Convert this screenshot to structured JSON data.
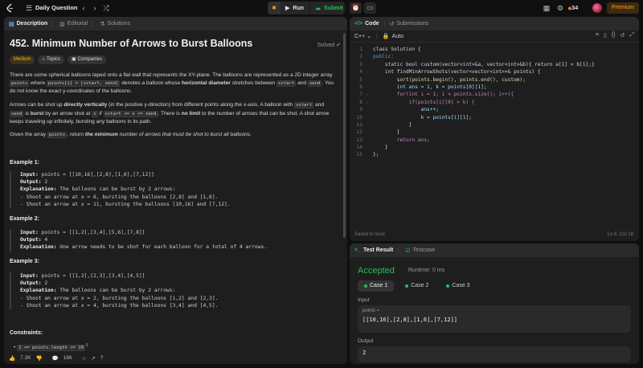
{
  "topbar": {
    "title": "Daily Question",
    "run_label": "Run",
    "submit_label": "Submit",
    "streak": "34",
    "premium_label": "Premium"
  },
  "left_tabs": [
    "Description",
    "Editorial",
    "Solutions"
  ],
  "problem": {
    "title": "452. Minimum Number of Arrows to Burst Balloons",
    "status": "Solved",
    "difficulty": "Medium",
    "topics_label": "Topics",
    "companies_label": "Companies",
    "p1_a": "There are some spherical balloons taped onto a flat wall that represents the XY-plane. The balloons are represented as a 2D integer array ",
    "p1_code1": "points",
    "p1_b": " where ",
    "p1_code2": "points[i] = [xstart, xend]",
    "p1_c": " denotes a balloon whose ",
    "p1_bold": "horizontal diameter",
    "p1_d": " stretches between ",
    "p1_code3": "xstart",
    "p1_e": " and ",
    "p1_code4": "xend",
    "p1_f": ". You do not know the exact y-coordinates of the balloons.",
    "p2_a": "Arrows can be shot up ",
    "p2_bold1": "directly vertically",
    "p2_b": " (in the positive y-direction) from different points along the x-axis. A balloon with ",
    "p2_code1": "xstart",
    "p2_c": " and ",
    "p2_code2": "xend",
    "p2_d": " is ",
    "p2_bold2": "burst",
    "p2_e": " by an arrow shot at ",
    "p2_code3": "x",
    "p2_f": " if ",
    "p2_code4": "xstart <= x <= xend",
    "p2_g": ". There is ",
    "p2_bold3": "no limit",
    "p2_h": " to the number of arrows that can be shot. A shot arrow keeps traveling up infinitely, bursting any balloons in its path.",
    "p3_a": "Given the array ",
    "p3_code": "points",
    "p3_b": ", return ",
    "p3_em": "the minimum",
    "p3_c": " number of arrows that must be shot to burst all balloons.",
    "examples": [
      {
        "title": "Example 1:",
        "input": "points = [[10,16],[2,8],[1,6],[7,12]]",
        "output": "2",
        "explanation": "The balloons can be burst by 2 arrows:",
        "lines": [
          "- Shoot an arrow at x = 6, bursting the balloons [2,8] and [1,6].",
          "- Shoot an arrow at x = 11, bursting the balloons [10,16] and [7,12]."
        ]
      },
      {
        "title": "Example 2:",
        "input": "points = [[1,2],[3,4],[5,6],[7,8]]",
        "output": "4",
        "explanation": "One arrow needs to be shot for each balloon for a total of 4 arrows.",
        "lines": []
      },
      {
        "title": "Example 3:",
        "input": "points = [[1,2],[2,3],[3,4],[4,5]]",
        "output": "2",
        "explanation": "The balloons can be burst by 2 arrows:",
        "lines": [
          "- Shoot an arrow at x = 2, bursting the balloons [1,2] and [2,3].",
          "- Shoot an arrow at x = 4, bursting the balloons [3,4] and [4,5]."
        ]
      }
    ],
    "constraints_title": "Constraints:",
    "constraint1": "1 <= points.length <= 10"
  },
  "bottombar": {
    "likes": "7.2K",
    "comments": "166"
  },
  "code_tabs": [
    "Code",
    "Submissions"
  ],
  "language": "C++",
  "auto_label": "Auto",
  "saved_label": "Saved to local",
  "cursor_pos": "Ln 8, Col 18",
  "code_lines": [
    "class Solution {",
    "public:",
    "    static bool custom(vector<int>&a, vector<int>&b){ return a[1] < b[1];}",
    "    int findMinArrowShots(vector<vector<int>>& points) {",
    "        sort(points.begin(), points.end(), custom);",
    "        int ans = 1, k = points[0][1];",
    "        for(int i = 1; i < points.size(); i++){",
    "            if(points[i][0] > k) {",
    "                ans++;",
    "                k = points[i][1];",
    "            }",
    "        }",
    "        return ans;",
    "    }",
    "};"
  ],
  "result_tabs": [
    "Test Result",
    "Testcase"
  ],
  "result": {
    "status": "Accepted",
    "runtime": "Runtime: 0 ms",
    "cases": [
      "Case 1",
      "Case 2",
      "Case 3"
    ],
    "input_label": "Input",
    "var_name": "points =",
    "input_value": "[[10,16],[2,8],[1,6],[7,12]]",
    "output_label": "Output",
    "output_value": "2"
  },
  "colors": {
    "accent": "#ffa116",
    "success": "#2cbb5d",
    "medium": "#ffb800"
  }
}
